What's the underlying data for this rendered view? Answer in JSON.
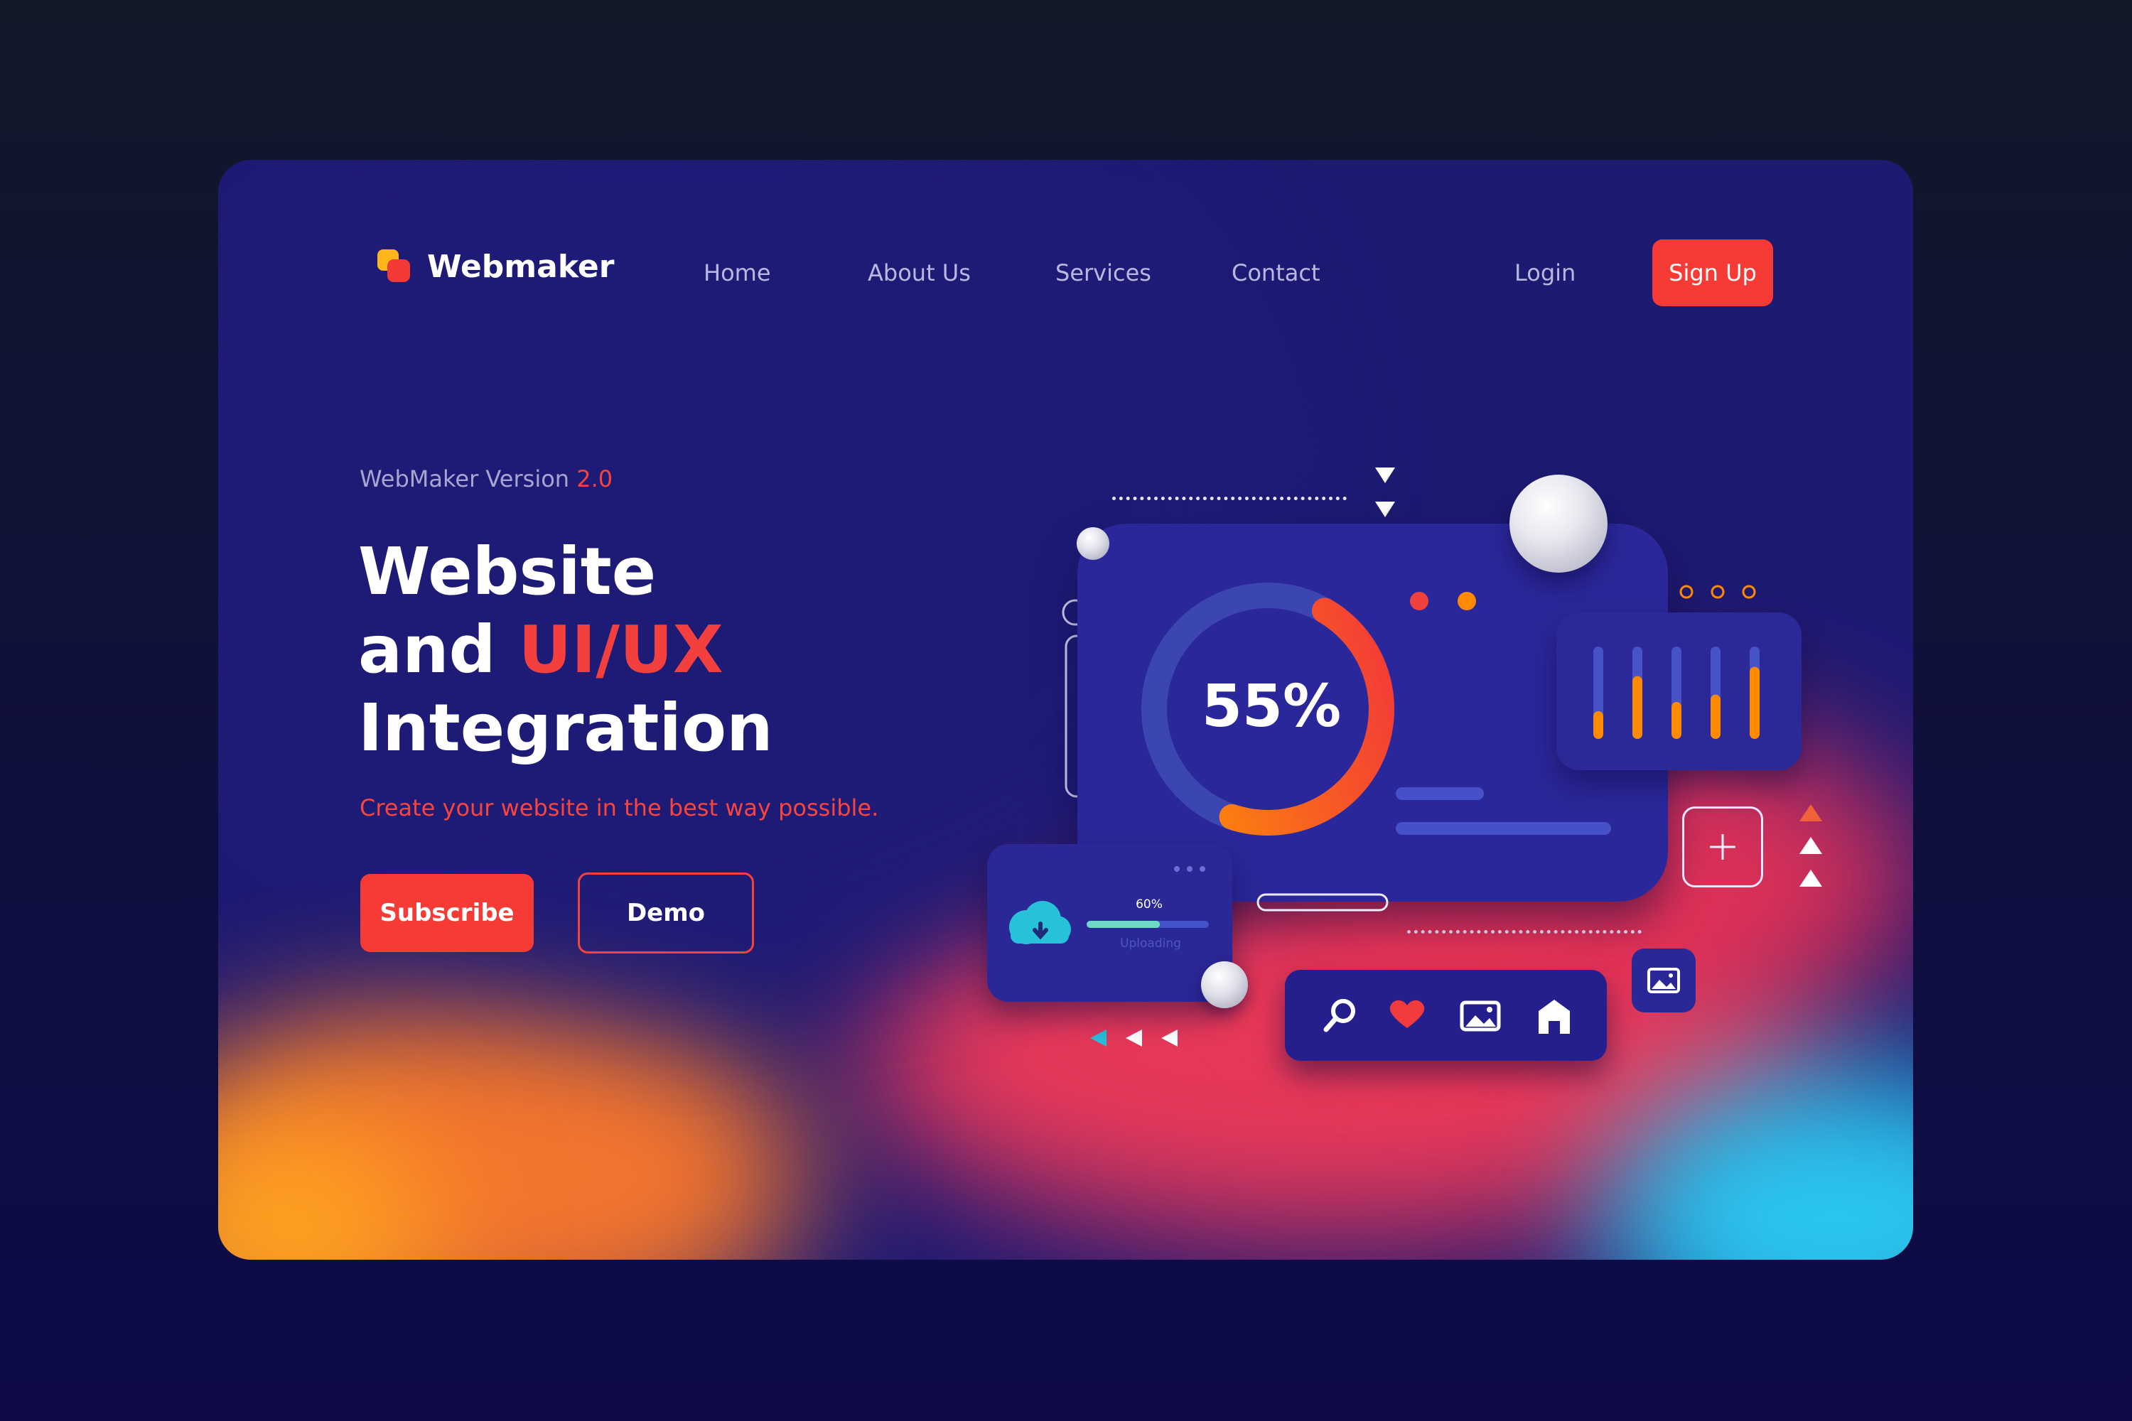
{
  "brand": {
    "name": "Webmaker"
  },
  "nav": {
    "home": "Home",
    "about": "About Us",
    "services": "Services",
    "contact": "Contact",
    "login": "Login",
    "signup": "Sign Up"
  },
  "hero": {
    "version_label": "WebMaker Version",
    "version_number": "2.0",
    "headline_line1": "Website",
    "headline_line2_prefix": "and",
    "headline_line2_accent": "UI/UX",
    "headline_line3": "Integration",
    "tagline": "Create your website in the best way possible.",
    "subscribe_label": "Subscribe",
    "demo_label": "Demo"
  },
  "dashboard": {
    "donut_label": "55%",
    "donut_progress": 0.55,
    "bar_levels": [
      0.3,
      0.68,
      0.4,
      0.48,
      0.78
    ],
    "upload_percent_label": "60%",
    "upload_progress": 0.6,
    "upload_status": "Uploading"
  },
  "icons": [
    "search-icon",
    "heart-icon",
    "image-icon",
    "home-icon",
    "plus-icon",
    "cloud-download-icon"
  ],
  "colors": {
    "accent": "#f63b36",
    "orange": "#ff8a00",
    "card_bg": "#1d1a72",
    "panel_bg": "#282597"
  }
}
